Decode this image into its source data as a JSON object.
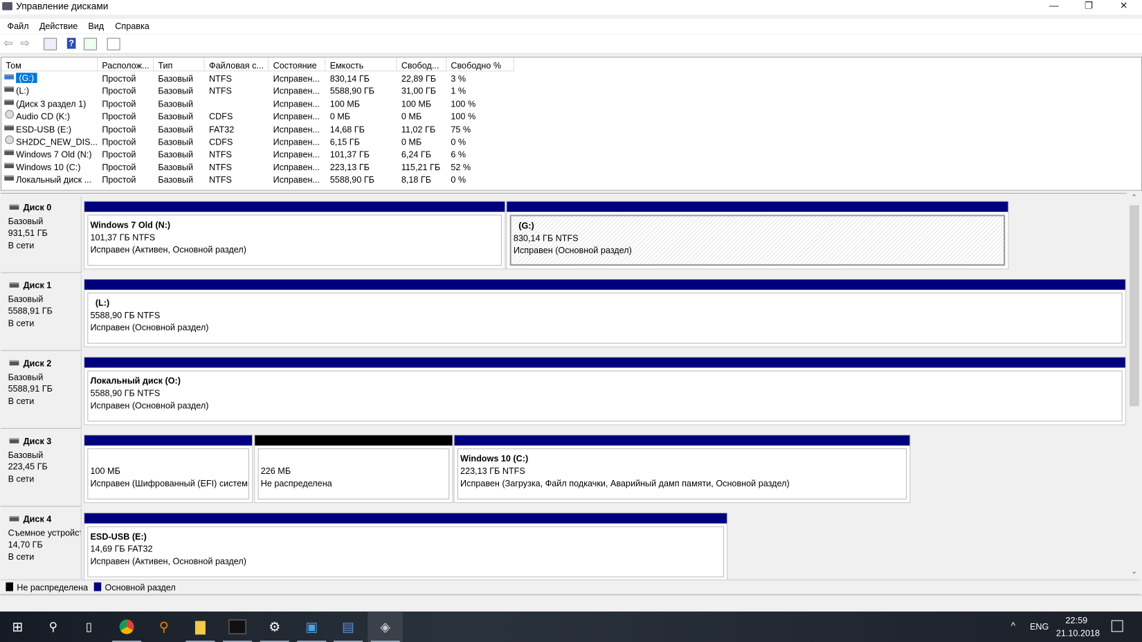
{
  "window": {
    "title": "Управление дисками",
    "minimize": "—",
    "restore": "❐",
    "close": "✕"
  },
  "menu": [
    "Файл",
    "Действие",
    "Вид",
    "Справка"
  ],
  "table": {
    "columns": [
      "Том",
      "Располож...",
      "Тип",
      "Файловая с...",
      "Состояние",
      "Емкость",
      "Свобод...",
      "Свободно %"
    ],
    "rows": [
      {
        "icon": "drive",
        "name": "(G:)",
        "layout": "Простой",
        "type": "Базовый",
        "fs": "NTFS",
        "status": "Исправен...",
        "capacity": "830,14 ГБ",
        "free": "22,89 ГБ",
        "pct": "3 %",
        "selected": true
      },
      {
        "icon": "drive",
        "name": "(L:)",
        "layout": "Простой",
        "type": "Базовый",
        "fs": "NTFS",
        "status": "Исправен...",
        "capacity": "5588,90 ГБ",
        "free": "31,00 ГБ",
        "pct": "1 %"
      },
      {
        "icon": "drive",
        "name": "(Диск 3 раздел 1)",
        "layout": "Простой",
        "type": "Базовый",
        "fs": "",
        "status": "Исправен...",
        "capacity": "100 МБ",
        "free": "100 МБ",
        "pct": "100 %"
      },
      {
        "icon": "cd",
        "name": "Audio CD (K:)",
        "layout": "Простой",
        "type": "Базовый",
        "fs": "CDFS",
        "status": "Исправен...",
        "capacity": "0 МБ",
        "free": "0 МБ",
        "pct": "100 %"
      },
      {
        "icon": "drive",
        "name": "ESD-USB (E:)",
        "layout": "Простой",
        "type": "Базовый",
        "fs": "FAT32",
        "status": "Исправен...",
        "capacity": "14,68 ГБ",
        "free": "11,02 ГБ",
        "pct": "75 %"
      },
      {
        "icon": "cd",
        "name": "SH2DC_NEW_DIS...",
        "layout": "Простой",
        "type": "Базовый",
        "fs": "CDFS",
        "status": "Исправен...",
        "capacity": "6,15 ГБ",
        "free": "0 МБ",
        "pct": "0 %"
      },
      {
        "icon": "drive",
        "name": "Windows 7 Old (N:)",
        "layout": "Простой",
        "type": "Базовый",
        "fs": "NTFS",
        "status": "Исправен...",
        "capacity": "101,37 ГБ",
        "free": "6,24 ГБ",
        "pct": "6 %"
      },
      {
        "icon": "drive",
        "name": "Windows 10 (C:)",
        "layout": "Простой",
        "type": "Базовый",
        "fs": "NTFS",
        "status": "Исправен...",
        "capacity": "223,13 ГБ",
        "free": "115,21 ГБ",
        "pct": "52 %"
      },
      {
        "icon": "drive",
        "name": "Локальный диск ...",
        "layout": "Простой",
        "type": "Базовый",
        "fs": "NTFS",
        "status": "Исправен...",
        "capacity": "5588,90 ГБ",
        "free": "8,18 ГБ",
        "pct": "0 %"
      }
    ]
  },
  "disks": [
    {
      "name": "Диск 0",
      "kind": "Базовый",
      "size": "931,51 ГБ",
      "state": "В сети"
    },
    {
      "name": "Диск 1",
      "kind": "Базовый",
      "size": "5588,91 ГБ",
      "state": "В сети"
    },
    {
      "name": "Диск 2",
      "kind": "Базовый",
      "size": "5588,91 ГБ",
      "state": "В сети"
    },
    {
      "name": "Диск 3",
      "kind": "Базовый",
      "size": "223,45 ГБ",
      "state": "В сети"
    },
    {
      "name": "Диск 4",
      "kind": "Съемное устройство",
      "size": "14,70 ГБ",
      "state": "В сети"
    }
  ],
  "partitions": {
    "d0p0": {
      "title": "Windows 7 Old  (N:)",
      "size": "101,37 ГБ NTFS",
      "status": "Исправен (Активен, Основной раздел)"
    },
    "d0p1": {
      "title": "(G:)",
      "size": "830,14 ГБ NTFS",
      "status": "Исправен (Основной раздел)"
    },
    "d1p0": {
      "title": "(L:)",
      "size": "5588,90 ГБ NTFS",
      "status": "Исправен (Основной раздел)"
    },
    "d2p0": {
      "title": "Локальный диск  (O:)",
      "size": "5588,90 ГБ NTFS",
      "status": "Исправен (Основной раздел)"
    },
    "d3p0": {
      "size": "100 МБ",
      "status": "Исправен (Шифрованный (EFI) системный раздел)"
    },
    "d3p1": {
      "size": "226 МБ",
      "status": "Не распределена"
    },
    "d3p2": {
      "title": "Windows 10  (C:)",
      "size": "223,13 ГБ NTFS",
      "status": "Исправен (Загрузка, Файл подкачки, Аварийный дамп памяти, Основной раздел)"
    },
    "d4p0": {
      "title": "ESD-USB  (E:)",
      "size": "14,69 ГБ FAT32",
      "status": "Исправен (Активен, Основной раздел)"
    }
  },
  "legend": [
    {
      "label": "Не распределена",
      "color": "#000000"
    },
    {
      "label": "Основной раздел",
      "color": "#00007f"
    }
  ],
  "taskbar": {
    "lang": "ENG",
    "time": "22:59",
    "date": "21.10.2018",
    "tray_arrow": "^"
  }
}
